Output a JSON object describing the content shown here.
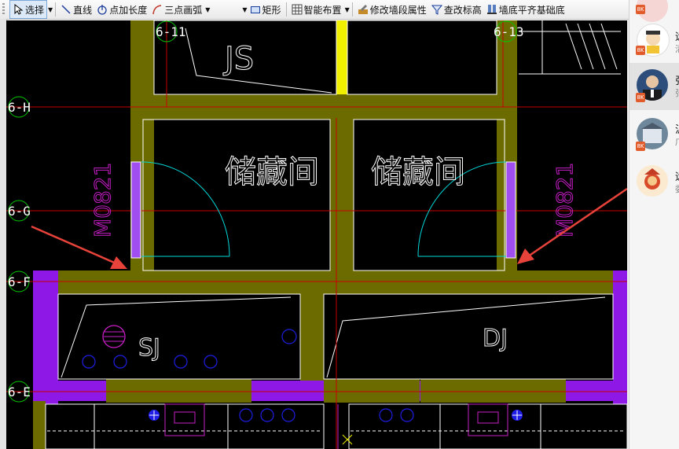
{
  "toolbar": {
    "select_label": "选择",
    "line_label": "直线",
    "point_length_label": "点加长度",
    "three_point_arc_label": "三点画弧",
    "rect_label": "矩形",
    "smart_layout_label": "智能布置",
    "modify_wall_label": "修改墙段属性",
    "check_elevation_label": "查改标高",
    "wall_bottom_label": "墙底平齐基础底"
  },
  "drawing": {
    "rooms": {
      "storage_left": "储藏间",
      "storage_right": "储藏间",
      "js": "JS",
      "sj": "SJ",
      "dj": "DJ"
    },
    "doors": {
      "left": "M0821",
      "right": "M0821"
    },
    "axes": {
      "h": "6-H",
      "g": "6-G",
      "f": "6-F",
      "e": "6-E",
      "top_left": "6-11",
      "top_right": "6-13"
    },
    "colors": {
      "wall": "#6b6b00",
      "purple_wall": "#8e19e6",
      "grid_line": "#c80000",
      "door_arc": "#00d7d7",
      "door_label": "#c81ec8",
      "yellow_column": "#f0f000",
      "circle_blue": "#1e1ee6",
      "arrow": "#e8433a",
      "axis_bubble": "#00c800"
    }
  },
  "panel": {
    "contacts": [
      {
        "name": "远",
        "sub": "清"
      },
      {
        "name": "张",
        "sub": "张"
      },
      {
        "name": "泥",
        "sub": "广"
      },
      {
        "name": "远",
        "sub": "委"
      }
    ],
    "badge": "8K"
  }
}
